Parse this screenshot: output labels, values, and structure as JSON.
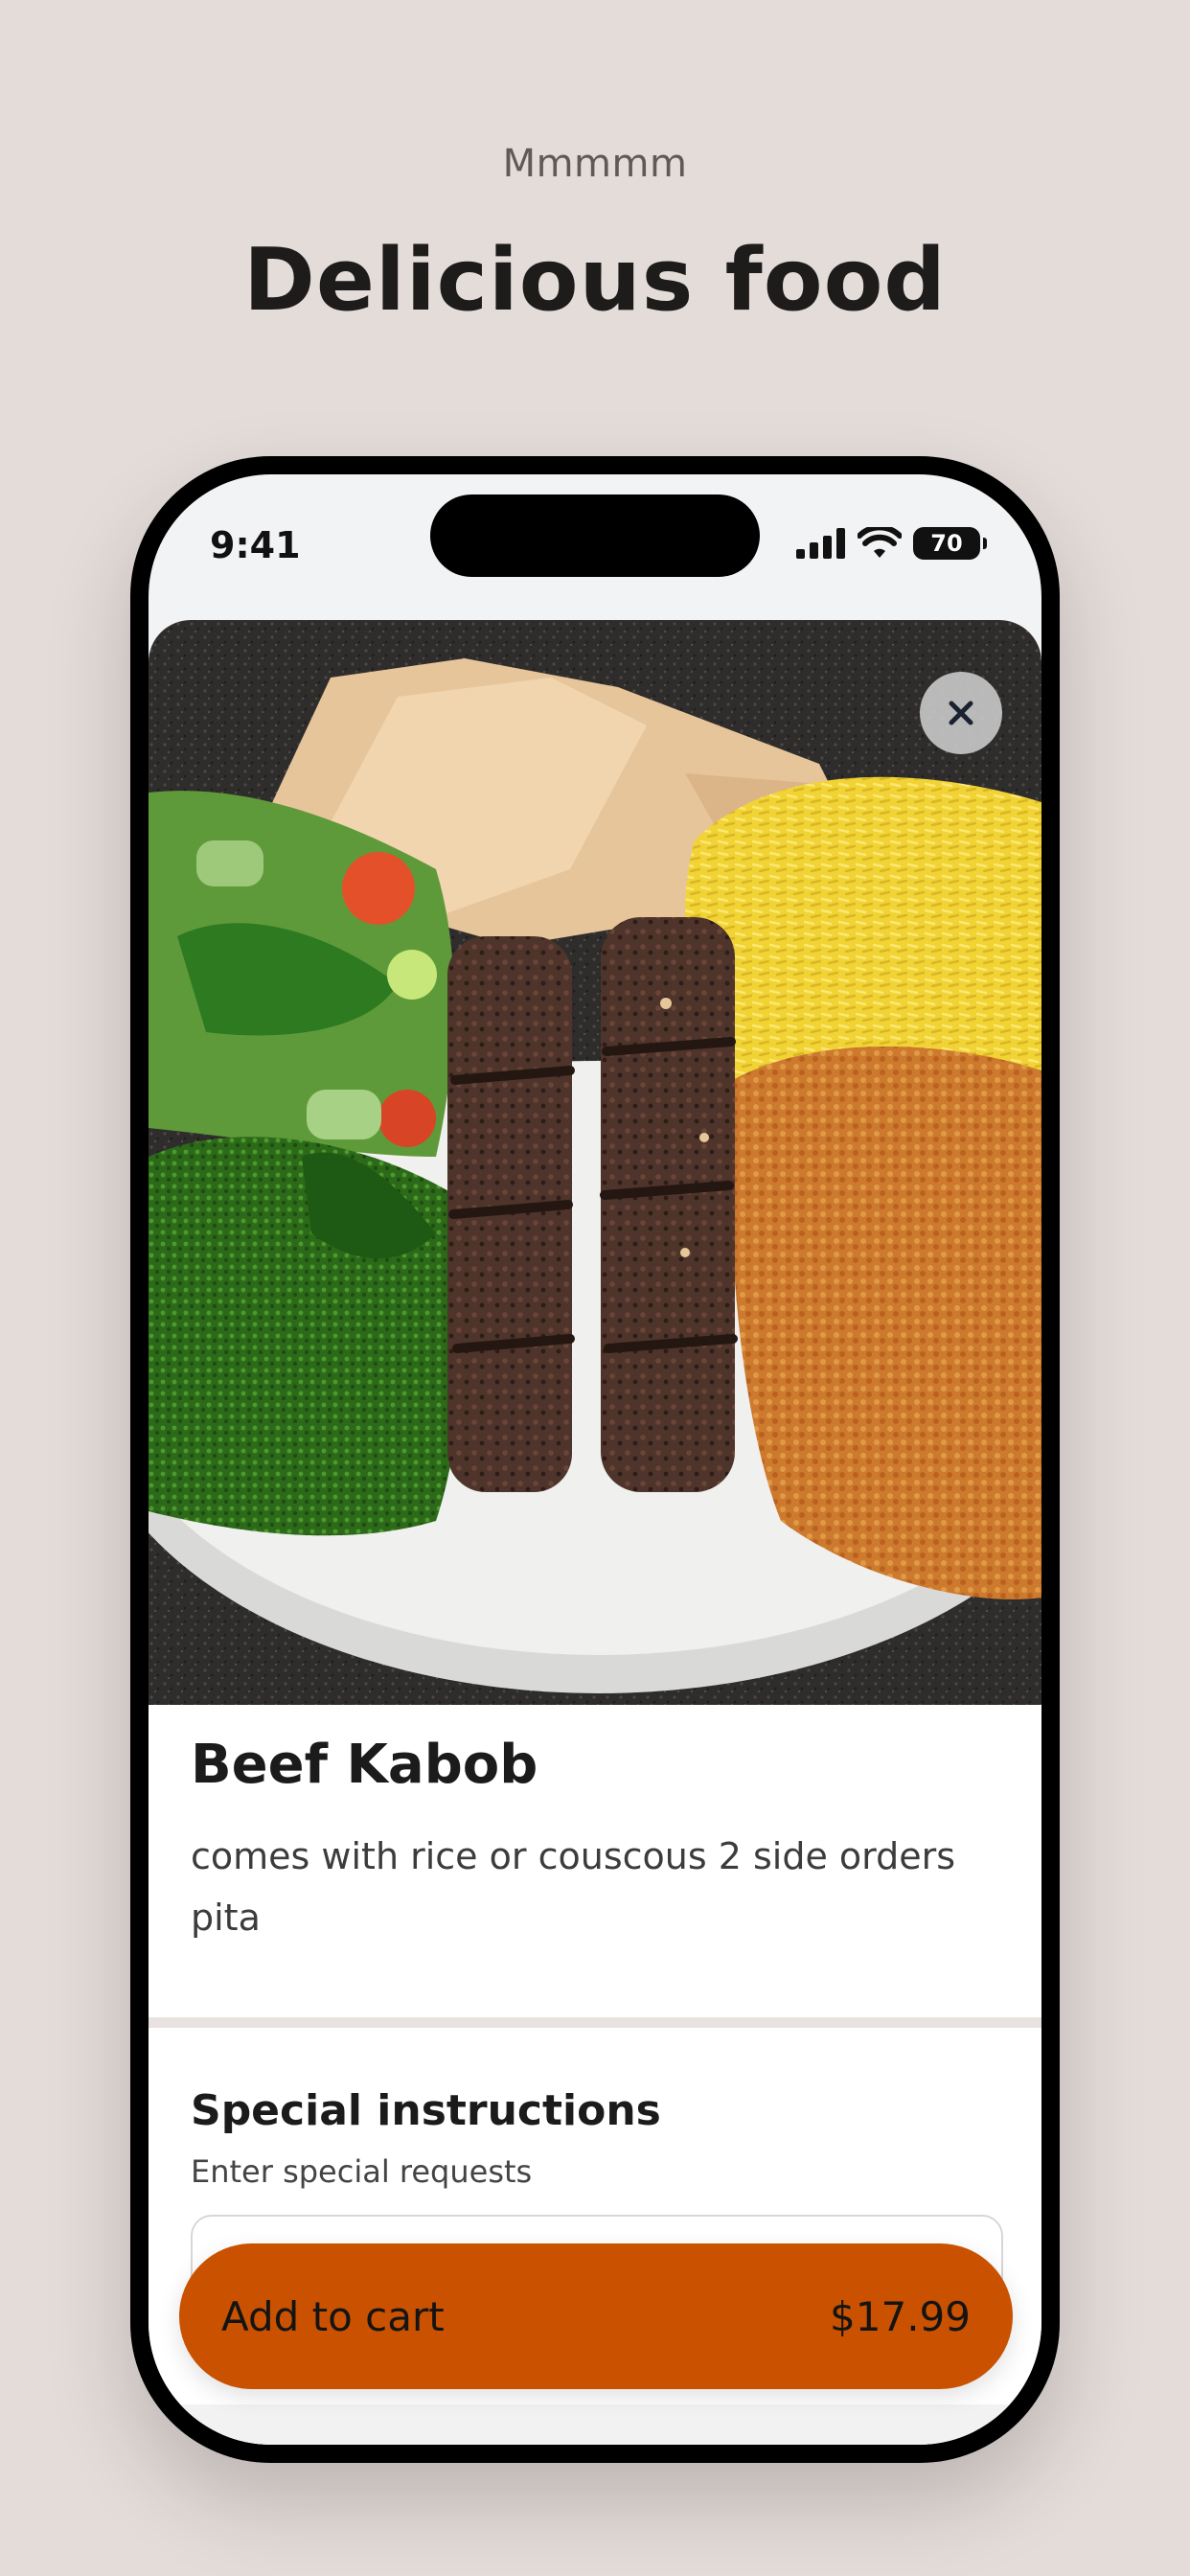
{
  "header": {
    "kicker": "Mmmmm",
    "headline": "Delicious food"
  },
  "status_bar": {
    "time": "9:41",
    "battery": "70",
    "icons": [
      "cellular-signal-icon",
      "wifi-icon",
      "battery-icon"
    ]
  },
  "item": {
    "image_description": "beef-kabob-plate-photo",
    "name": "Beef Kabob",
    "description": "comes with rice or couscous 2 side orders pita"
  },
  "special_instructions": {
    "title": "Special instructions",
    "subtitle": "Enter special requests",
    "value": ""
  },
  "cart_button": {
    "label": "Add to cart",
    "price": "$17.99"
  },
  "colors": {
    "background": "#e4dcd9",
    "accent": "#c95100"
  }
}
